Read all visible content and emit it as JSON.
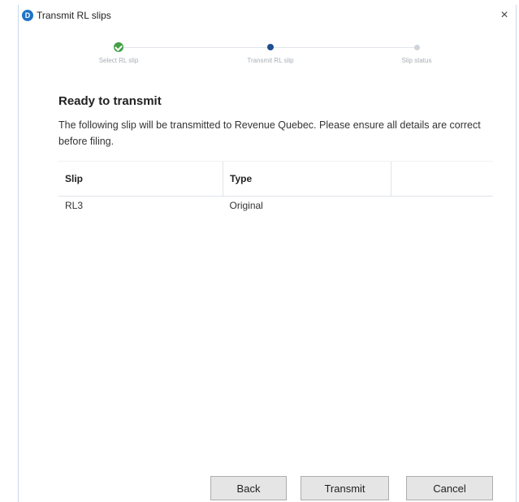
{
  "window": {
    "title": "Transmit RL slips",
    "app_icon_letter": "D",
    "close_glyph": "×"
  },
  "stepper": {
    "steps": [
      {
        "label": "Select RL slip",
        "state": "done"
      },
      {
        "label": "Transmit RL slip",
        "state": "active"
      },
      {
        "label": "Slip status",
        "state": "pending"
      }
    ]
  },
  "content": {
    "heading": "Ready to transmit",
    "description": "The following slip will be transmitted to Revenue Quebec. Please ensure all details are correct before filing.",
    "table": {
      "headers": [
        "Slip",
        "Type",
        ""
      ],
      "rows": [
        [
          "RL3",
          "Original",
          ""
        ]
      ]
    }
  },
  "footer": {
    "back_label": "Back",
    "transmit_label": "Transmit",
    "cancel_label": "Cancel"
  },
  "colors": {
    "done": "#43a047",
    "active": "#1f4f8f",
    "pending": "#cfd4da",
    "app_icon": "#1f73c8"
  },
  "icons": [
    "app-logo-icon",
    "close-icon",
    "checkmark-icon"
  ]
}
